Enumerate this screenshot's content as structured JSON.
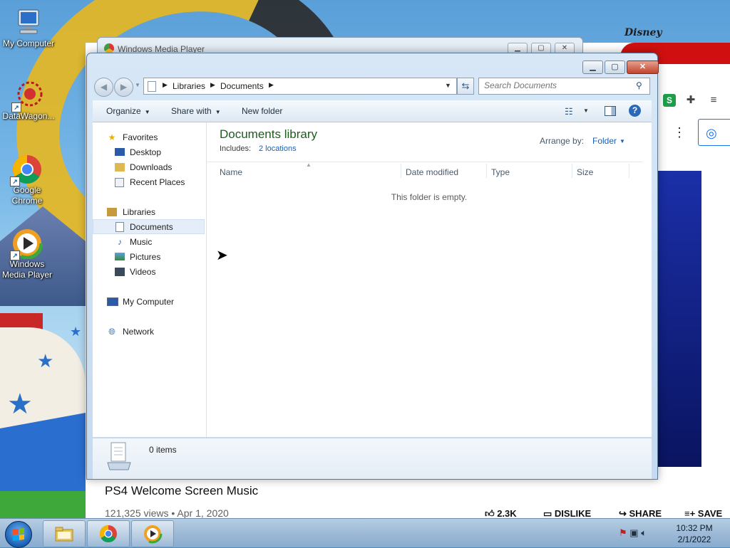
{
  "desktop": {
    "icons": [
      {
        "label_line1": "My Computer",
        "label_line2": ""
      },
      {
        "label_line1": "DataWagon...",
        "label_line2": ""
      },
      {
        "label_line1": "Google",
        "label_line2": "Chrome"
      },
      {
        "label_line1": "Windows",
        "label_line2": "Media Player"
      }
    ]
  },
  "background_browser": {
    "disney_text": "Disney",
    "ext_s_label": "S",
    "video_title": "PS4 Welcome Screen Music",
    "video_meta": "121,325 views • Apr 1, 2020",
    "like_count": "2.3K",
    "dislike_label": "DISLIKE",
    "share_label": "SHARE",
    "save_label": "SAVE"
  },
  "wmp_window": {
    "title": "Windows Media Player"
  },
  "explorer": {
    "breadcrumb": [
      "Libraries",
      "Documents"
    ],
    "search_placeholder": "Search Documents",
    "toolbar": {
      "organize": "Organize",
      "share_with": "Share with",
      "new_folder": "New folder"
    },
    "nav": {
      "favorites": "Favorites",
      "desktop": "Desktop",
      "downloads": "Downloads",
      "recent_places": "Recent Places",
      "libraries": "Libraries",
      "documents": "Documents",
      "music": "Music",
      "pictures": "Pictures",
      "videos": "Videos",
      "my_computer": "My Computer",
      "network": "Network"
    },
    "library": {
      "title": "Documents library",
      "includes_label": "Includes:",
      "locations_link": "2 locations",
      "arrange_label": "Arrange by:",
      "arrange_value": "Folder"
    },
    "columns": [
      "Name",
      "Date modified",
      "Type",
      "Size"
    ],
    "empty_message": "This folder is empty.",
    "details": {
      "item_count": "0 items"
    }
  },
  "taskbar": {
    "clock_time": "10:32 PM",
    "clock_date": "2/1/2022"
  },
  "colors": {
    "library_title": "#1e5c1e",
    "link": "#1a5fb4",
    "close_button": "#c0442c"
  }
}
